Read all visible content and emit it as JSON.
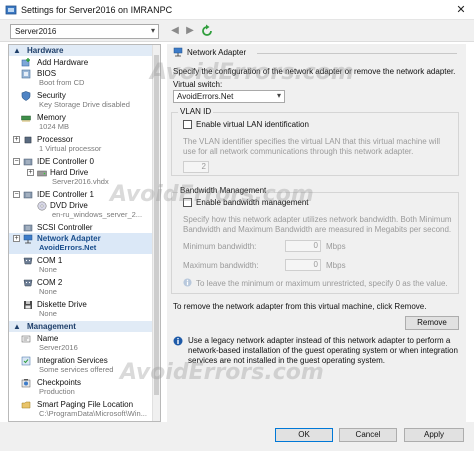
{
  "window": {
    "title": "Settings for Server2016 on IMRANPC",
    "close_glyph": "✕"
  },
  "toolbar": {
    "vm_name": "Server2016",
    "back_glyph": "◀",
    "forward_glyph": "▶"
  },
  "tree": {
    "hardware_header": "Hardware",
    "management_header": "Management",
    "hardware_items": [
      {
        "label": "Add Hardware",
        "sub": "",
        "icon": "add-hardware-icon"
      },
      {
        "label": "BIOS",
        "sub": "Boot from CD",
        "icon": "bios-icon"
      },
      {
        "label": "Security",
        "sub": "Key Storage Drive disabled",
        "icon": "security-icon"
      },
      {
        "label": "Memory",
        "sub": "1024 MB",
        "icon": "memory-icon"
      },
      {
        "label": "Processor",
        "sub": "1 Virtual processor",
        "icon": "processor-icon"
      },
      {
        "label": "IDE Controller 0",
        "sub": "",
        "icon": "ide-controller-icon"
      },
      {
        "label": "Hard Drive",
        "sub": "Server2016.vhdx",
        "icon": "hard-drive-icon"
      },
      {
        "label": "IDE Controller 1",
        "sub": "",
        "icon": "ide-controller-icon"
      },
      {
        "label": "DVD Drive",
        "sub": "en-ru_windows_server_2...",
        "icon": "dvd-drive-icon"
      },
      {
        "label": "SCSI Controller",
        "sub": "",
        "icon": "scsi-controller-icon"
      },
      {
        "label": "Network Adapter",
        "sub": "AvoidErrors.Net",
        "icon": "network-adapter-icon"
      },
      {
        "label": "COM 1",
        "sub": "None",
        "icon": "com-port-icon"
      },
      {
        "label": "COM 2",
        "sub": "None",
        "icon": "com-port-icon"
      },
      {
        "label": "Diskette Drive",
        "sub": "None",
        "icon": "diskette-drive-icon"
      }
    ],
    "management_items": [
      {
        "label": "Name",
        "sub": "Server2016",
        "icon": "name-icon"
      },
      {
        "label": "Integration Services",
        "sub": "Some services offered",
        "icon": "integration-services-icon"
      },
      {
        "label": "Checkpoints",
        "sub": "Production",
        "icon": "checkpoints-icon"
      },
      {
        "label": "Smart Paging File Location",
        "sub": "C:\\ProgramData\\Microsoft\\Win...",
        "icon": "smart-paging-icon"
      }
    ]
  },
  "panel": {
    "header": "Network Adapter",
    "description": "Specify the configuration of the network adapter or remove the network adapter.",
    "virtual_switch_label": "Virtual switch:",
    "virtual_switch_value": "AvoidErrors.Net",
    "vlan": {
      "title": "VLAN ID",
      "checkbox_label": "Enable virtual LAN identification",
      "description": "The VLAN identifier specifies the virtual LAN that this virtual machine will use for all network communications through this network adapter.",
      "value": "2"
    },
    "bandwidth": {
      "title": "Bandwidth Management",
      "checkbox_label": "Enable bandwidth management",
      "description": "Specify how this network adapter utilizes network bandwidth. Both Minimum Bandwidth and Maximum Bandwidth are measured in Megabits per second.",
      "min_label": "Minimum bandwidth:",
      "min_value": "0",
      "max_label": "Maximum bandwidth:",
      "max_value": "0",
      "unit": "Mbps",
      "hint": "To leave the minimum or maximum unrestricted, specify 0 as the value."
    },
    "remove_text": "To remove the network adapter from this virtual machine, click Remove.",
    "remove_button": "Remove",
    "info_text": "Use a legacy network adapter instead of this network adapter to perform a network-based installation of the guest operating system or when integration services are not installed in the guest operating system."
  },
  "buttons": {
    "ok": "OK",
    "cancel": "Cancel",
    "apply": "Apply"
  },
  "watermark": "AvoidErrors.com",
  "colors": {
    "accent": "#0078d7",
    "selected_bg": "#dbe8f7",
    "section_header_bg": "#e1ebf6",
    "panel_bg": "#f0f0f0"
  }
}
